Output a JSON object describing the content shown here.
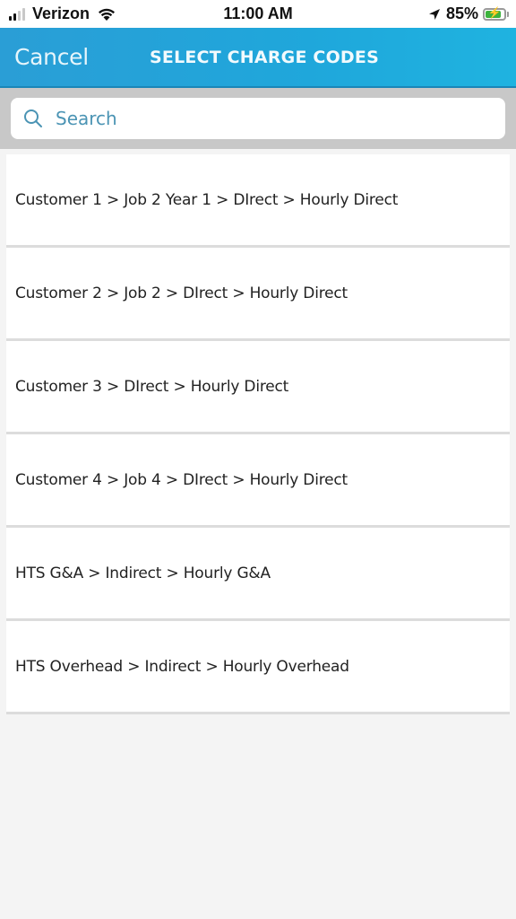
{
  "status_bar": {
    "carrier": "Verizon",
    "time": "11:00 AM",
    "battery_percent_label": "85%",
    "battery_level": 0.85,
    "signal_bars": 2,
    "icons": [
      "signal-icon",
      "wifi-icon",
      "location-arrow-icon",
      "battery-charging-icon"
    ]
  },
  "nav": {
    "cancel_label": "Cancel",
    "title": "SELECT CHARGE CODES",
    "background_color": "#1fa7db"
  },
  "search": {
    "placeholder": "Search",
    "value": "",
    "icon": "search-icon"
  },
  "charge_codes": [
    {
      "label": "Customer 1 > Job 2 Year 1 > DIrect > Hourly Direct"
    },
    {
      "label": "Customer 2 > Job 2 > DIrect > Hourly Direct"
    },
    {
      "label": "Customer 3 > DIrect > Hourly Direct"
    },
    {
      "label": "Customer 4 > Job 4 > DIrect > Hourly Direct"
    },
    {
      "label": "HTS G&A > Indirect > Hourly G&A"
    },
    {
      "label": "HTS Overhead > Indirect > Hourly Overhead"
    }
  ]
}
